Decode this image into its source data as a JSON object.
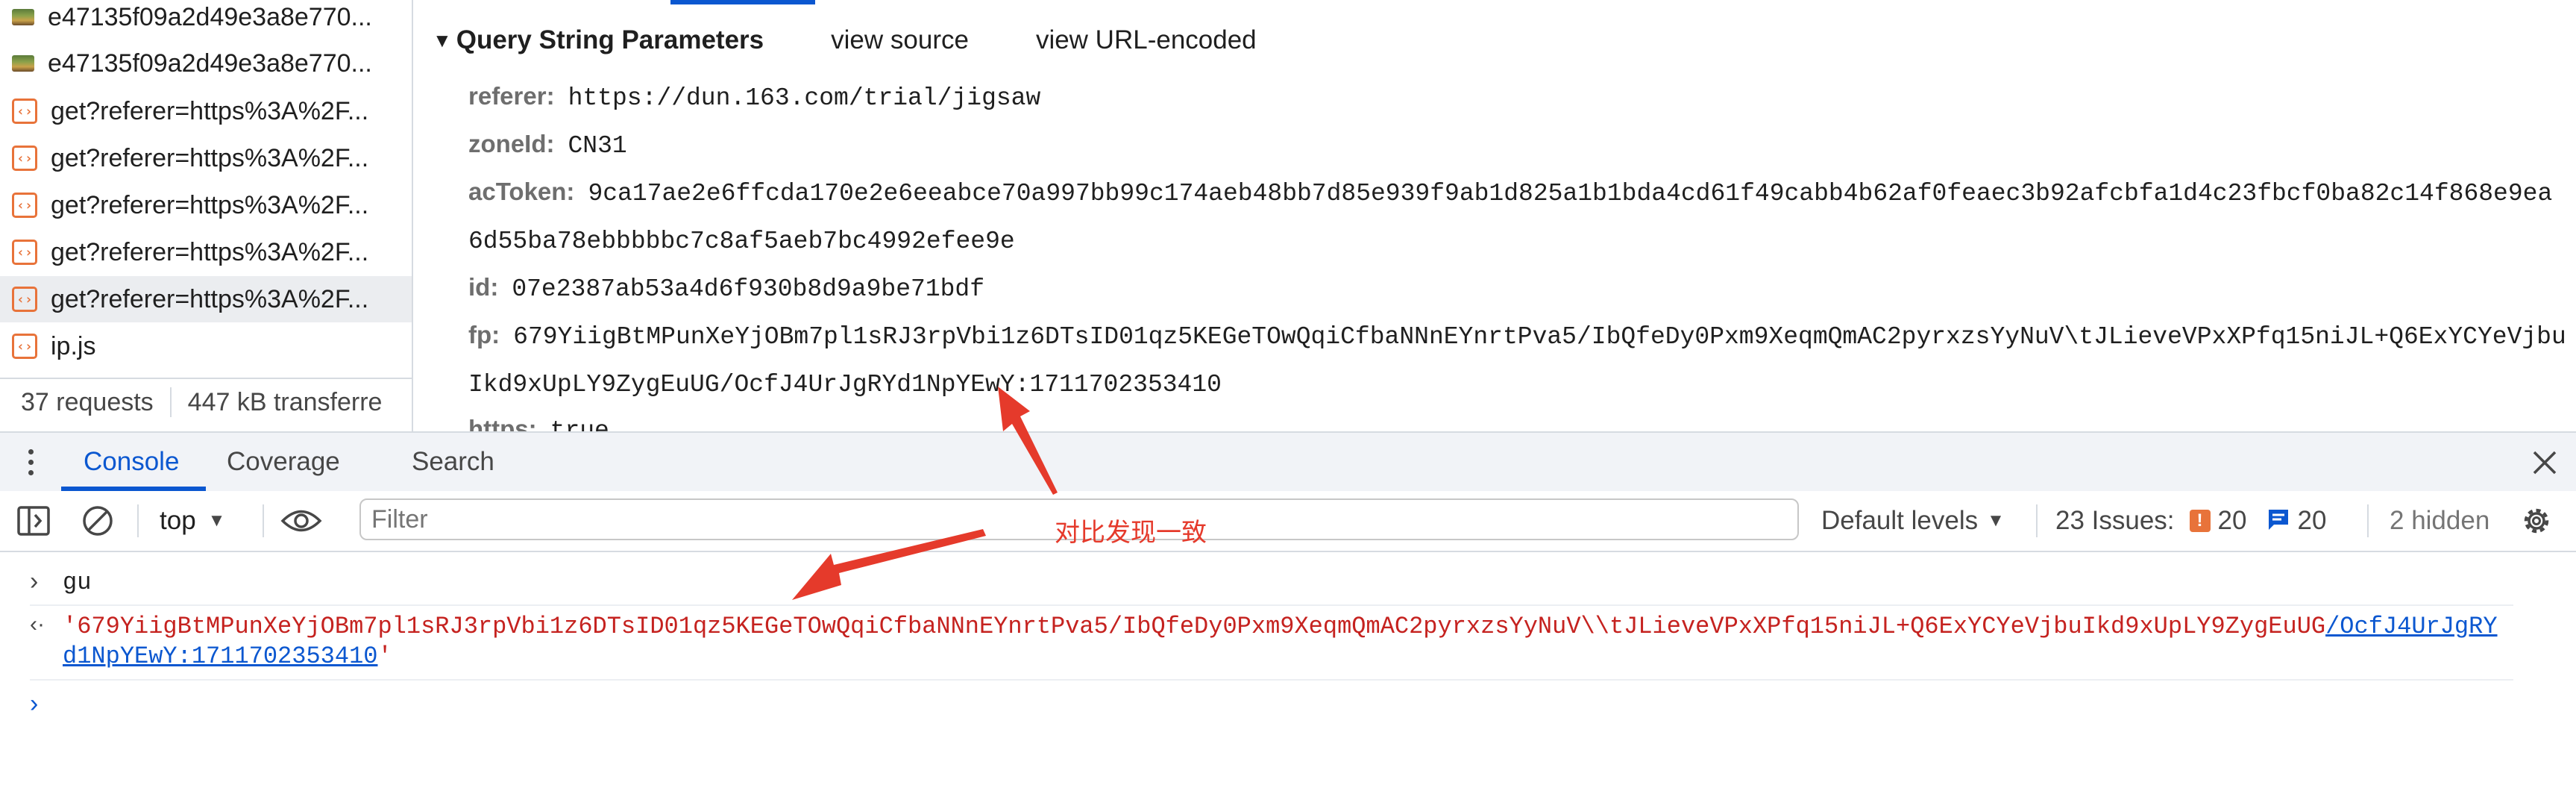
{
  "network": {
    "requests": [
      {
        "name": "e47135f09a2d49e3a8e770...",
        "type": "image"
      },
      {
        "name": "e47135f09a2d49e3a8e770...",
        "type": "image"
      },
      {
        "name": "get?referer=https%3A%2F...",
        "type": "xhr"
      },
      {
        "name": "get?referer=https%3A%2F...",
        "type": "xhr"
      },
      {
        "name": "get?referer=https%3A%2F...",
        "type": "xhr"
      },
      {
        "name": "get?referer=https%3A%2F...",
        "type": "xhr"
      },
      {
        "name": "get?referer=https%3A%2F...",
        "type": "xhr",
        "selected": true
      },
      {
        "name": "ip.js",
        "type": "xhr"
      }
    ],
    "summary": {
      "requests": "37 requests",
      "transferred": "447 kB transferre"
    }
  },
  "params": {
    "section_title": "Query String Parameters",
    "view_source": "view source",
    "view_url_encoded": "view URL-encoded",
    "rows": [
      {
        "key": "referer:",
        "value": "https://dun.163.com/trial/jigsaw"
      },
      {
        "key": "zoneId:",
        "value": "CN31"
      },
      {
        "key": "acToken:",
        "value": "9ca17ae2e6ffcda170e2e6eeabce70a997bb99c174aeb48bb7d85e939f9ab1d825a1b1bda4cd61f49cabb4b62af0feaec3b92afcbfa1d4c23fbcf0ba82c14f868e9ea",
        "cont": "6d55ba78ebbbbbc7c8af5aeb7bc4992efee9e"
      },
      {
        "key": "id:",
        "value": "07e2387ab53a4d6f930b8d9a9be71bdf"
      },
      {
        "key": "fp:",
        "value": "679YiigBtMPunXeYjOBm7pl1sRJ3rpVbi1z6DTsID01qz5KEGeTOwQqiCfbaNNnEYnrtPva5/IbQfeDy0Pxm9XeqmQmAC2pyrxzsYyNuV\\tJLieveVPxXPfq15niJL+Q6ExYCYeVjbu",
        "cont": "Ikd9xUpLY9ZygEuUG/OcfJ4UrJgRYd1NpYEwY:1711702353410"
      },
      {
        "key": "https:",
        "value": "true"
      }
    ]
  },
  "drawer": {
    "tabs": [
      "Console",
      "Coverage",
      "Search"
    ],
    "active_tab": "Console"
  },
  "toolbar": {
    "context": "top",
    "filter_placeholder": "Filter",
    "levels": "Default levels",
    "issues_label": "23 Issues:",
    "issues_warn": "20",
    "issues_info": "20",
    "hidden": "2 hidden"
  },
  "console": {
    "input": "gu",
    "result_plain": "'679YiigBtMPunXeYjOBm7pl1sRJ3rpVbi1z6DTsID01qz5KEGeTOwQqiCfbaNNnEYnrtPva5/IbQfeDy0Pxm9XeqmQmAC2pyrxzsYyNuV\\\\tJLieveVPxXPfq15niJL+Q6ExYCYeVjbuIkd9xUpLY9ZygEuUG",
    "result_link": "/OcfJ4UrJgRYd1NpYEwY:1711702353410",
    "result_end": "'"
  },
  "annotation": {
    "text": "对比发现一致",
    "color": "#e53a2b"
  },
  "colors": {
    "accent": "#0b57d0",
    "string_red": "#c5221f",
    "warn_orange": "#e8733a"
  }
}
